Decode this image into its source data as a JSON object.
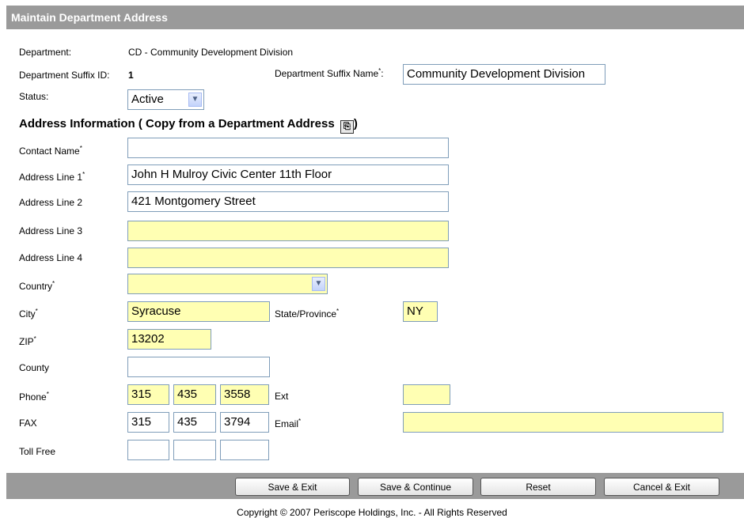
{
  "header": {
    "title": "Maintain Department Address"
  },
  "department": {
    "label": "Department:",
    "value": "CD - Community Development Division"
  },
  "suffix_id": {
    "label": "Department Suffix ID:",
    "value": "1"
  },
  "suffix_name": {
    "label": "Department Suffix Name",
    "value": "Community Development Division"
  },
  "status": {
    "label": "Status:",
    "value": "Active"
  },
  "section": {
    "title": "Address Information ( Copy from a Department Address ",
    "title_end": ")"
  },
  "contact_name": {
    "label": "Contact Name",
    "value": ""
  },
  "address1": {
    "label": "Address Line 1",
    "value": "John H Mulroy Civic Center 11th Floor"
  },
  "address2": {
    "label": "Address Line 2",
    "value": "421 Montgomery Street"
  },
  "address3": {
    "label": "Address Line 3",
    "value": ""
  },
  "address4": {
    "label": "Address Line 4",
    "value": ""
  },
  "country": {
    "label": "Country",
    "value": ""
  },
  "city": {
    "label": "City",
    "value": "Syracuse"
  },
  "state": {
    "label": "State/Province",
    "value": "NY"
  },
  "zip": {
    "label": "ZIP",
    "value": "13202"
  },
  "county": {
    "label": "County",
    "value": ""
  },
  "phone": {
    "label": "Phone",
    "area": "315",
    "prefix": "435",
    "line": "3558",
    "ext_label": "Ext",
    "ext": ""
  },
  "fax": {
    "label": "FAX",
    "area": "315",
    "prefix": "435",
    "line": "3794",
    "email_label": "Email",
    "email": ""
  },
  "toll_free": {
    "label": "Toll Free",
    "area": "",
    "prefix": "",
    "line": ""
  },
  "required_mark": "*",
  "buttons": {
    "save_exit": "Save & Exit",
    "save_continue": "Save & Continue",
    "reset": "Reset",
    "cancel_exit": "Cancel & Exit"
  },
  "footer": {
    "copyright": "Copyright © 2007 Periscope Holdings, Inc. - All Rights Reserved"
  },
  "colors": {
    "header": "#9a9a9a",
    "required_field": "#ffffb3",
    "field_border": "#7f9db9"
  }
}
